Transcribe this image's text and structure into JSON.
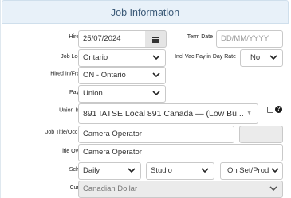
{
  "header": {
    "title": "Job Information"
  },
  "fields": {
    "hire_date": {
      "label": "Hire Date",
      "value": "25/07/2024"
    },
    "term_date": {
      "label": "Term Date",
      "placeholder": "DD/MM/YYYY"
    },
    "job_location": {
      "label": "Job Location",
      "value": "Ontario"
    },
    "incl_vac_pay": {
      "label": "Incl Vac Pay in Day Rate",
      "value": "No"
    },
    "hired_in_from": {
      "label": "Hired In/From",
      "value": "ON - Ontario"
    },
    "pay_type": {
      "label": "Pay Type",
      "value": "Union"
    },
    "union_info": {
      "label": "Union Info",
      "value": "891 IATSE Local 891 Canada — (Low Bu..."
    },
    "job_title": {
      "label": "Job Title/Occ Code",
      "value": "Camera Operator",
      "code": ""
    },
    "title_override": {
      "label": "Title Override",
      "value": "Camera Operator"
    },
    "schedule": {
      "label": "Schedule",
      "values": [
        "Daily",
        "Studio",
        "On Set/Prod"
      ]
    },
    "currency": {
      "label": "Currency",
      "value": "Canadian Dollar"
    }
  },
  "icons": {
    "help": "help-circle-icon",
    "calendar": "calendar-icon",
    "dropdown": "chevron-down-icon"
  }
}
